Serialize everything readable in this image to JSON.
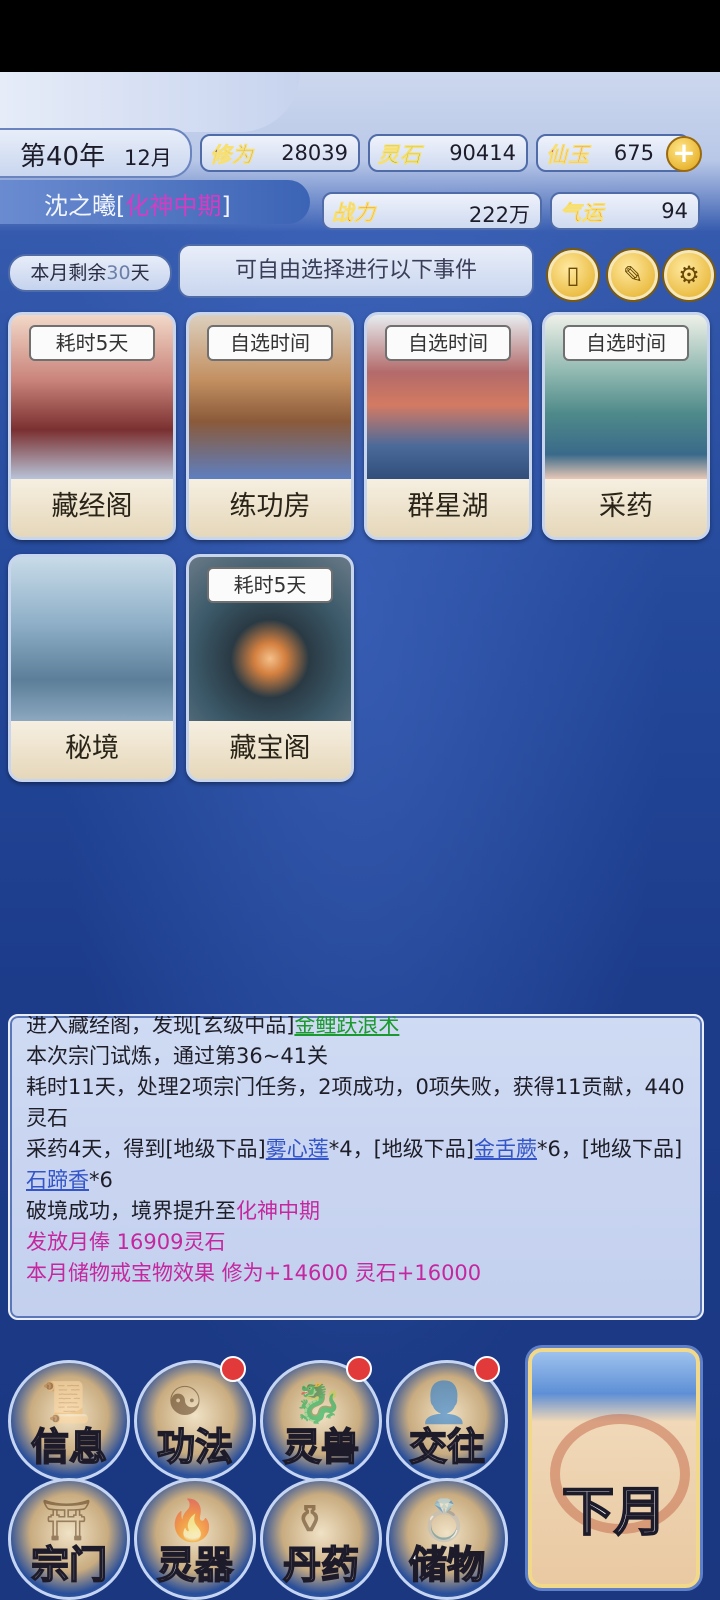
{
  "header": {
    "year": "第40年",
    "month": "12月",
    "name": "沈之曦",
    "realm": "化神中期",
    "stats": {
      "cultivation": {
        "label": "修为",
        "value": "28039"
      },
      "spirit_stone": {
        "label": "灵石",
        "value": "90414"
      },
      "jade": {
        "label": "仙玉",
        "value": "675"
      },
      "power": {
        "label": "战力",
        "value": "222万"
      },
      "luck": {
        "label": "气运",
        "value": "94"
      }
    }
  },
  "month_bar": {
    "remaining_prefix": "本月剩余",
    "remaining_days": "30",
    "remaining_suffix": "天",
    "prompt": "可自由选择进行以下事件"
  },
  "events": [
    {
      "name": "藏经阁",
      "time": "耗时5天"
    },
    {
      "name": "练功房",
      "time": "自选时间"
    },
    {
      "name": "群星湖",
      "time": "自选时间"
    },
    {
      "name": "采药",
      "time": "自选时间"
    },
    {
      "name": "秘境",
      "time": ""
    },
    {
      "name": "藏宝阁",
      "time": "耗时5天"
    }
  ],
  "log": {
    "l0_a": "进入藏经阁，发现[玄级中品]",
    "l0_b": "金鲤跃浪术",
    "l1": "本次宗门试炼，通过第36~41关",
    "l2": "耗时11天，处理2项宗门任务，2项成功，0项失败，获得11贡献，440灵石",
    "l3_a": "采药4天，得到[地级下品]",
    "l3_b": "雾心莲",
    "l3_c": "*4，[地级下品]",
    "l3_d": "金舌蕨",
    "l3_e": "*6，[地级下品]",
    "l3_f": "石蹄香",
    "l3_g": "*6",
    "l4_a": "破境成功，境界提升至",
    "l4_b": "化神中期",
    "l5": "发放月俸 16909灵石",
    "l6": "本月储物戒宝物效果 修为+14600 灵石+16000"
  },
  "nav": {
    "info": "信息",
    "technique": "功法",
    "beast": "灵兽",
    "social": "交往",
    "sect": "宗门",
    "artifact": "灵器",
    "pill": "丹药",
    "storage": "储物",
    "next_month": "下月"
  },
  "colors": {
    "realm": "#d43cc4",
    "log_item": "#3355c8",
    "log_green": "#1a9a2e",
    "log_pink": "#c4279e",
    "badge": "#e23a3a"
  }
}
